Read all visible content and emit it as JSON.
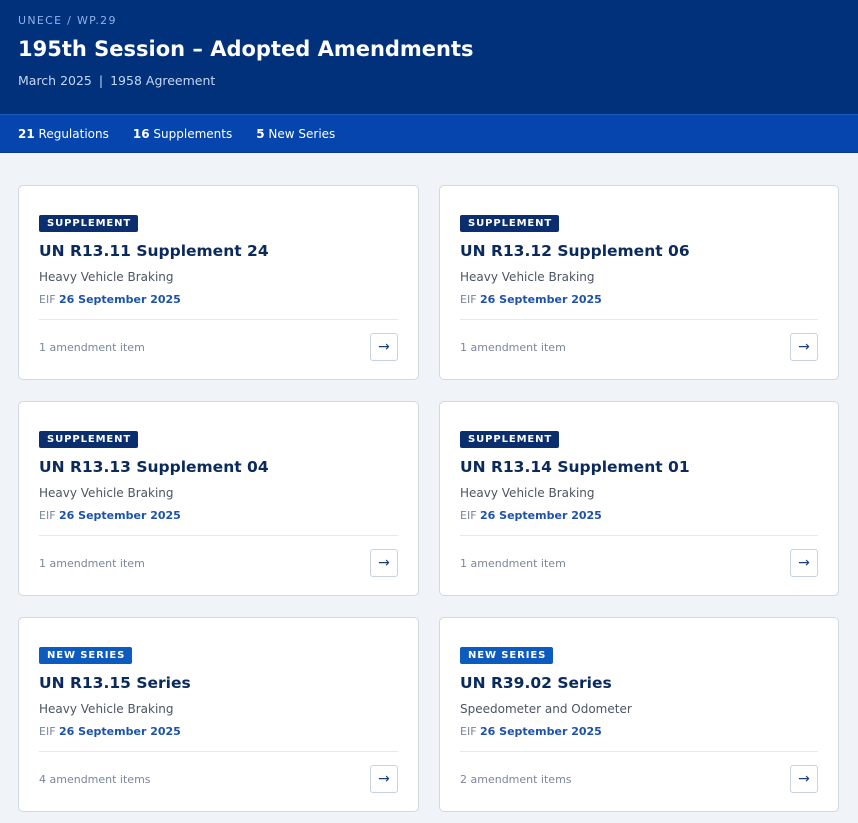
{
  "header": {
    "eyebrow": "UNECE / WP.29",
    "title": "195th Session – Adopted Amendments",
    "date": "March 2025",
    "separator": "|",
    "agreement": "1958 Agreement"
  },
  "stats": [
    {
      "count": "21",
      "label": "Regulations"
    },
    {
      "count": "16",
      "label": "Supplements"
    },
    {
      "count": "5",
      "label": "New Series"
    }
  ],
  "eif_label": "EIF",
  "arrow_icon": "→",
  "cards": [
    {
      "badge": "SUPPLEMENT",
      "title": "UN R13.11 Supplement 24",
      "desc": "Heavy Vehicle Braking",
      "eif_date": "26 September 2025",
      "items": "1 amendment item"
    },
    {
      "badge": "SUPPLEMENT",
      "title": "UN R13.12 Supplement 06",
      "desc": "Heavy Vehicle Braking",
      "eif_date": "26 September 2025",
      "items": "1 amendment item"
    },
    {
      "badge": "SUPPLEMENT",
      "title": "UN R13.13 Supplement 04",
      "desc": "Heavy Vehicle Braking",
      "eif_date": "26 September 2025",
      "items": "1 amendment item"
    },
    {
      "badge": "SUPPLEMENT",
      "title": "UN R13.14 Supplement 01",
      "desc": "Heavy Vehicle Braking",
      "eif_date": "26 September 2025",
      "items": "1 amendment item"
    },
    {
      "badge": "NEW SERIES",
      "title": "UN R13.15 Series",
      "desc": "Heavy Vehicle Braking",
      "eif_date": "26 September 2025",
      "items": "4 amendment items"
    },
    {
      "badge": "NEW SERIES",
      "title": "UN R39.02 Series",
      "desc": "Speedometer and Odometer",
      "eif_date": "26 September 2025",
      "items": "2 amendment items"
    }
  ],
  "colors": {
    "header_bg": "#00317a",
    "stats_bg": "#0545ad",
    "badge_supplement": "#0b2f6e",
    "badge_new_series": "#0d5bbf",
    "title_text": "#0b2a5c",
    "date_accent": "#1d52a8"
  }
}
